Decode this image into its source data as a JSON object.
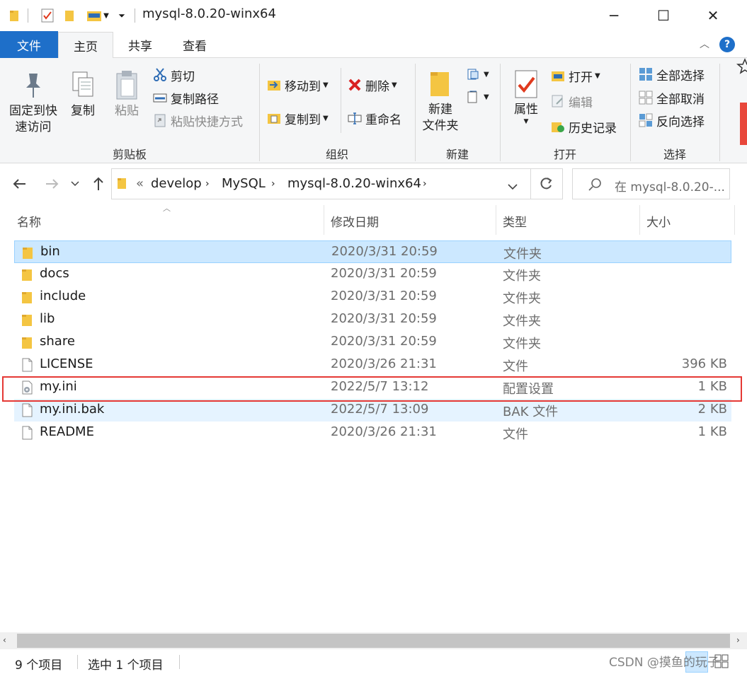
{
  "window": {
    "title": "mysql-8.0.20-winx64",
    "minimize_glyph": "─",
    "maximize_glyph": "☐",
    "close_glyph": "✕"
  },
  "tabs": [
    "文件",
    "主页",
    "共享",
    "查看"
  ],
  "ribbon": {
    "clipboard": {
      "label": "剪贴板",
      "pin": "固定到快\n速访问",
      "copy": "复制",
      "paste": "粘贴",
      "cut": "剪切",
      "copy_path": "复制路径",
      "paste_shortcut": "粘贴快捷方式"
    },
    "organize": {
      "label": "组织",
      "move_to": "移动到",
      "copy_to": "复制到",
      "delete": "删除",
      "rename": "重命名"
    },
    "new": {
      "label": "新建",
      "new_folder": "新建\n文件夹"
    },
    "open": {
      "label": "打开",
      "properties": "属性",
      "open": "打开",
      "edit": "编辑",
      "history": "历史记录"
    },
    "select": {
      "label": "选择",
      "select_all": "全部选择",
      "select_none": "全部取消",
      "invert": "反向选择"
    }
  },
  "address": {
    "overflow": "«",
    "crumbs": [
      "develop",
      "MySQL",
      "mysql-8.0.20-winx64"
    ],
    "search_placeholder": "在 mysql-8.0.20-..."
  },
  "columns": {
    "name": "名称",
    "date": "修改日期",
    "type": "类型",
    "size": "大小"
  },
  "files": [
    {
      "name": "bin",
      "date": "2020/3/31 20:59",
      "type": "文件夹",
      "size": "",
      "kind": "folder",
      "selected": true
    },
    {
      "name": "docs",
      "date": "2020/3/31 20:59",
      "type": "文件夹",
      "size": "",
      "kind": "folder"
    },
    {
      "name": "include",
      "date": "2020/3/31 20:59",
      "type": "文件夹",
      "size": "",
      "kind": "folder"
    },
    {
      "name": "lib",
      "date": "2020/3/31 20:59",
      "type": "文件夹",
      "size": "",
      "kind": "folder"
    },
    {
      "name": "share",
      "date": "2020/3/31 20:59",
      "type": "文件夹",
      "size": "",
      "kind": "folder"
    },
    {
      "name": "LICENSE",
      "date": "2020/3/26 21:31",
      "type": "文件",
      "size": "396 KB",
      "kind": "file"
    },
    {
      "name": "my.ini",
      "date": "2022/5/7 13:12",
      "type": "配置设置",
      "size": "1 KB",
      "kind": "ini",
      "highlighted": true
    },
    {
      "name": "my.ini.bak",
      "date": "2022/5/7 13:09",
      "type": "BAK 文件",
      "size": "2 KB",
      "kind": "file",
      "hover": true
    },
    {
      "name": "README",
      "date": "2020/3/26 21:31",
      "type": "文件",
      "size": "1 KB",
      "kind": "file"
    }
  ],
  "status": {
    "count": "9 个项目",
    "selected": "选中 1 个项目"
  },
  "watermark": "CSDN @摸鱼的玩子",
  "colors": {
    "accent": "#1e6fc9",
    "selection": "#cce8ff",
    "hover": "#e5f3ff",
    "highlight_box": "#e53935",
    "folder": "#f4c542"
  }
}
